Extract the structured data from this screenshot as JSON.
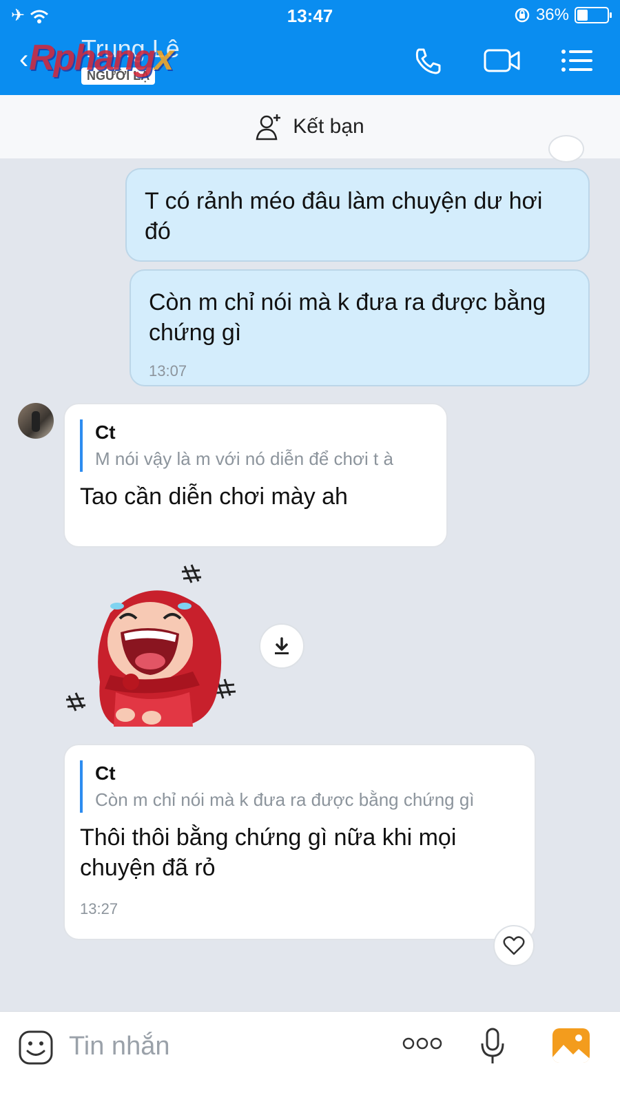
{
  "status_bar": {
    "time": "13:47",
    "battery": "36%",
    "battery_level": 0.36
  },
  "header": {
    "contact_name": "Trung Lê",
    "contact_tag": "NGƯỜI LẠ",
    "watermark_main": "Rphang",
    "watermark_x": "x"
  },
  "friend_bar": {
    "label": "Kết bạn"
  },
  "messages": [
    {
      "direction": "out",
      "text": "T có rảnh méo đâu làm chuyện dư hơi đó"
    },
    {
      "direction": "out",
      "text": "Còn m chỉ nói mà k đưa ra được bằng chứng gì",
      "time": "13:07"
    },
    {
      "direction": "in",
      "quote_name": "Ct",
      "quote_text": "M nói vậy là m với nó diễn để chơi t à",
      "text": "Tao cần diễn chơi mày ah"
    },
    {
      "direction": "in",
      "quote_name": "Ct",
      "quote_text": "Còn m chỉ nói mà k đưa ra được bằng chứng gì",
      "text": "Thôi thôi bằng chứng gì nữa khi mọi chuyện đã rỏ",
      "time": "13:27"
    }
  ],
  "input_bar": {
    "placeholder": "Tin nhắn"
  },
  "colors": {
    "header": "#0a8df0",
    "out_bubble": "#d4edfc",
    "in_bubble": "#ffffff",
    "accent": "#2d8cf0",
    "image_button": "#f39c1d"
  }
}
